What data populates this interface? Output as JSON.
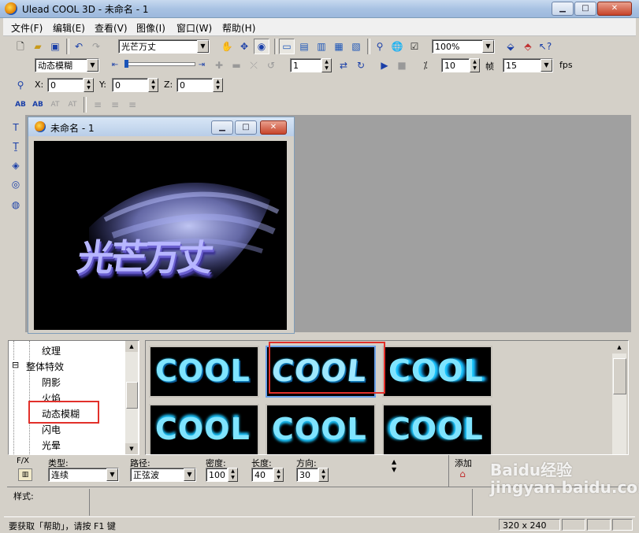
{
  "window": {
    "title": "Ulead COOL 3D - 未命名 - 1",
    "min": "▁",
    "max": "□",
    "close": "✕"
  },
  "menu": [
    "文件(F)",
    "编辑(E)",
    "查看(V)",
    "图像(I)",
    "窗口(W)",
    "帮助(H)"
  ],
  "toolbar1": {
    "text_object": "光芒万丈",
    "zoom": "100%"
  },
  "toolbar2": {
    "effect": "动态模糊",
    "frame_value": "1",
    "speed_value": "10",
    "frame_label": "帧",
    "fps_value": "15",
    "fps_label": "fps"
  },
  "toolbar3": {
    "x_label": "X:",
    "x_value": "0",
    "y_label": "Y:",
    "y_value": "0",
    "z_label": "Z:",
    "z_value": "0"
  },
  "toolbar4": {
    "btn1": "AB",
    "btn2": "AB",
    "btn3": "AT",
    "btn4": "AT"
  },
  "document": {
    "title": "未命名 - 1",
    "canvas_text": "光芒万丈"
  },
  "tree": [
    {
      "label": "纹理",
      "indent": 2
    },
    {
      "label": "整体特效",
      "indent": 1,
      "toggle": "⊟"
    },
    {
      "label": "阴影",
      "indent": 2
    },
    {
      "label": "火焰",
      "indent": 2
    },
    {
      "label": "动态模糊",
      "indent": 2,
      "highlighted": true
    },
    {
      "label": "闪电",
      "indent": 2
    },
    {
      "label": "光晕",
      "indent": 2
    }
  ],
  "thumbnails": [
    "COOL",
    "COOL",
    "COOL",
    "COOL",
    "COOL",
    "COOL"
  ],
  "params": {
    "fx_label": "F/X",
    "type_label": "类型:",
    "type_value": "连续",
    "path_label": "路径:",
    "path_value": "正弦波",
    "density_label": "密度:",
    "density_value": "100",
    "length_label": "长度:",
    "length_value": "40",
    "direction_label": "方向:",
    "direction_value": "30",
    "add_label": "添加"
  },
  "style_label": "样式:",
  "status": {
    "hint": "要获取「帮助」，请按 F1 键",
    "size": "320 x 240"
  },
  "watermark": "Baidu经验 jingyan.baidu.com",
  "colors": {
    "highlight_box": "#e2302a",
    "canvas_bg": "#000000",
    "thumb_text": "#7fe4ff"
  }
}
